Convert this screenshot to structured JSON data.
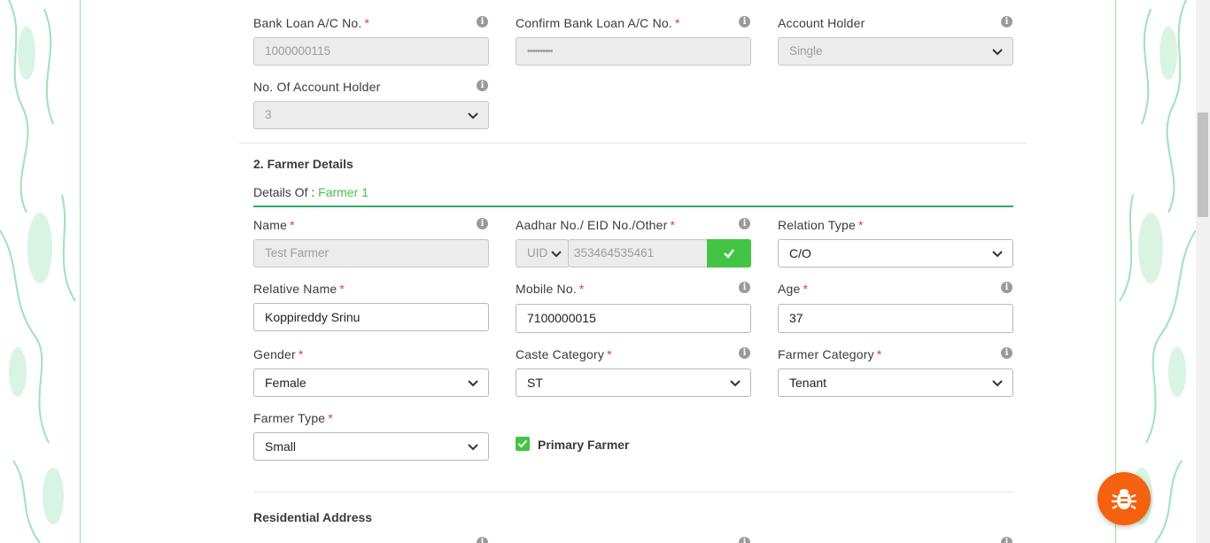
{
  "bank": {
    "loan_ac": {
      "label": "Bank Loan A/C No.",
      "value": "1000000115"
    },
    "confirm_ac": {
      "label": "Confirm Bank Loan A/C No.",
      "value": "••••••••••"
    },
    "account_holder": {
      "label": "Account Holder",
      "value": "Single"
    },
    "num_holders": {
      "label": "No. Of Account Holder",
      "value": "3"
    }
  },
  "farmer": {
    "section_title": "2. Farmer Details",
    "details_of_label": "Details Of :",
    "details_of_value": "Farmer 1",
    "name": {
      "label": "Name",
      "value": "Test Farmer"
    },
    "aadhar": {
      "label": "Aadhar No./ EID No./Other",
      "id_type": "UID",
      "value": "353464535461"
    },
    "relation_type": {
      "label": "Relation Type",
      "value": "C/O"
    },
    "relative_name": {
      "label": "Relative Name",
      "value": "Koppireddy Srinu"
    },
    "mobile": {
      "label": "Mobile No.",
      "value": "7100000015"
    },
    "age": {
      "label": "Age",
      "value": "37"
    },
    "gender": {
      "label": "Gender",
      "value": "Female"
    },
    "caste": {
      "label": "Caste Category",
      "value": "ST"
    },
    "farmer_category": {
      "label": "Farmer Category",
      "value": "Tenant"
    },
    "farmer_type": {
      "label": "Farmer Type",
      "value": "Small"
    },
    "primary_farmer": {
      "label": "Primary Farmer",
      "checked": true
    }
  },
  "residential": {
    "section_title": "Residential Address"
  },
  "required_mark": "*",
  "info_glyph": "i",
  "colors": {
    "accent_green": "#43c443",
    "fab_orange": "#f5620f",
    "required_red": "#e03b3b"
  },
  "icons": {
    "verify": "check-icon",
    "fab": "bug-icon",
    "dropdown": "chevron-down-icon"
  }
}
